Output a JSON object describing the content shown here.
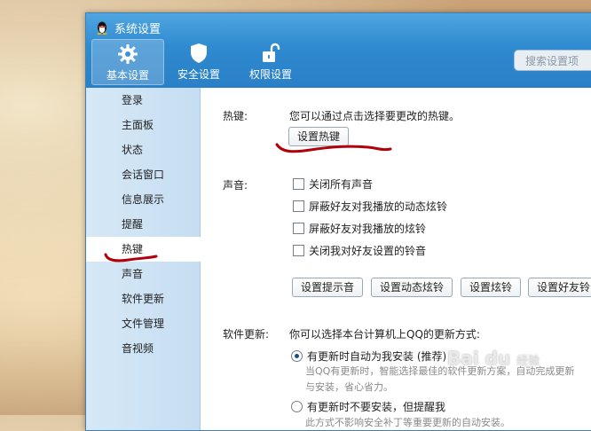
{
  "window": {
    "title": "系统设置"
  },
  "toolbar": {
    "items": [
      {
        "label": "基本设置",
        "icon": "gear-icon",
        "active": true
      },
      {
        "label": "安全设置",
        "icon": "shield-icon"
      },
      {
        "label": "权限设置",
        "icon": "unlock-icon"
      }
    ],
    "search_placeholder": "搜索设置项"
  },
  "sidebar": {
    "items": [
      {
        "label": "登录"
      },
      {
        "label": "主面板"
      },
      {
        "label": "状态"
      },
      {
        "label": "会话窗口"
      },
      {
        "label": "信息展示"
      },
      {
        "label": "提醒"
      },
      {
        "label": "热键",
        "active": true
      },
      {
        "label": "声音"
      },
      {
        "label": "软件更新"
      },
      {
        "label": "文件管理"
      },
      {
        "label": "音视频"
      }
    ]
  },
  "hotkey": {
    "label": "热键:",
    "description": "您可以通过点击选择要更改的热键。",
    "button": "设置热键"
  },
  "sound": {
    "label": "声音:",
    "options": [
      "关闭所有声音",
      "屏蔽好友对我播放的动态炫铃",
      "屏蔽好友对我播放的炫铃",
      "关闭我对好友设置的铃音"
    ],
    "buttons": [
      "设置提示音",
      "设置动态炫铃",
      "设置炫铃",
      "设置好友铃"
    ]
  },
  "update": {
    "label": "软件更新:",
    "description": "你可以选择本台计算机上QQ的更新方式:",
    "options": [
      {
        "label": "有更新时自动为我安装 (推荐)",
        "selected": true,
        "desc1": "当QQ有更新时，智能选择最佳的软件更新方案，自动完成更新",
        "desc2": "与安装，省心省力。"
      },
      {
        "label": "有更新时不要安装，但提醒我",
        "selected": false,
        "desc1": "此方式不影响安全补丁等重要更新的自动安装。"
      }
    ]
  },
  "watermark": {
    "brand": "Bai du",
    "sub": "经验"
  },
  "colors": {
    "titlebar": "#2f8ad0",
    "sidebar": "#c6def2",
    "annotation": "#b0000a"
  }
}
